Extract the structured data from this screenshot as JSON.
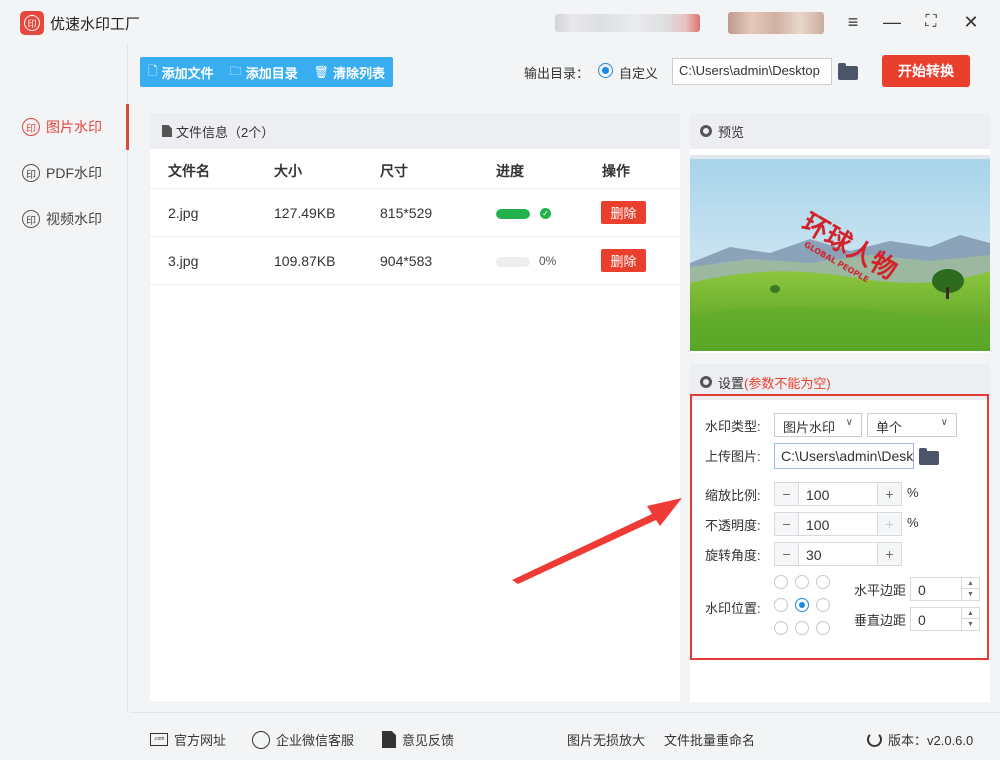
{
  "app": {
    "title": "优速水印工厂",
    "logo_char": "印"
  },
  "sidebar": {
    "items": [
      {
        "label": "图片水印",
        "icon": "印",
        "active": true
      },
      {
        "label": "PDF水印",
        "icon": "印",
        "active": false
      },
      {
        "label": "视频水印",
        "icon": "印",
        "active": false
      }
    ]
  },
  "toolbar": {
    "add_file": "添加文件",
    "add_folder": "添加目录",
    "clear_list": "清除列表",
    "output_label": "输出目录：",
    "output_option": "自定义",
    "output_path": "C:\\Users\\admin\\Desktop",
    "start_button": "开始转换"
  },
  "file_panel": {
    "title": "文件信息（2个）",
    "columns": [
      "文件名",
      "大小",
      "尺寸",
      "进度",
      "操作"
    ],
    "rows": [
      {
        "name": "2.jpg",
        "size": "127.49KB",
        "dims": "815*529",
        "progress": 1.0,
        "progress_text": "",
        "action": "删除"
      },
      {
        "name": "3.jpg",
        "size": "109.87KB",
        "dims": "904*583",
        "progress": 0.0,
        "progress_text": "0%",
        "action": "删除"
      }
    ]
  },
  "preview": {
    "title": "预览",
    "watermark_text": "环球人物",
    "watermark_subtext": "GLOBAL PEOPLE"
  },
  "settings": {
    "title": "设置",
    "warning": "(参数不能为空)",
    "watermark_type_label": "水印类型:",
    "watermark_type_value": "图片水印",
    "watermark_mode_value": "单个",
    "upload_label": "上传图片:",
    "upload_path": "C:\\Users\\admin\\Desktop",
    "scale_label": "缩放比例:",
    "scale_value": "100",
    "opacity_label": "不透明度:",
    "opacity_value": "100",
    "rotation_label": "旋转角度:",
    "rotation_value": "30",
    "percent": "%",
    "position_label": "水印位置:",
    "position_selected": 4,
    "h_margin_label": "水平边距",
    "h_margin_value": "0",
    "v_margin_label": "垂直边距",
    "v_margin_value": "0"
  },
  "footer": {
    "website": "官方网址",
    "wechat": "企业微信客服",
    "feedback": "意见反馈",
    "enlarge": "图片无损放大",
    "rename": "文件批量重命名",
    "version": "版本：v2.0.6.0",
    "web_icon_text": ".com"
  },
  "colors": {
    "accent": "#e9402e",
    "toolbar": "#38aef0",
    "progress": "#22b14c",
    "radio": "#1e88e5"
  }
}
